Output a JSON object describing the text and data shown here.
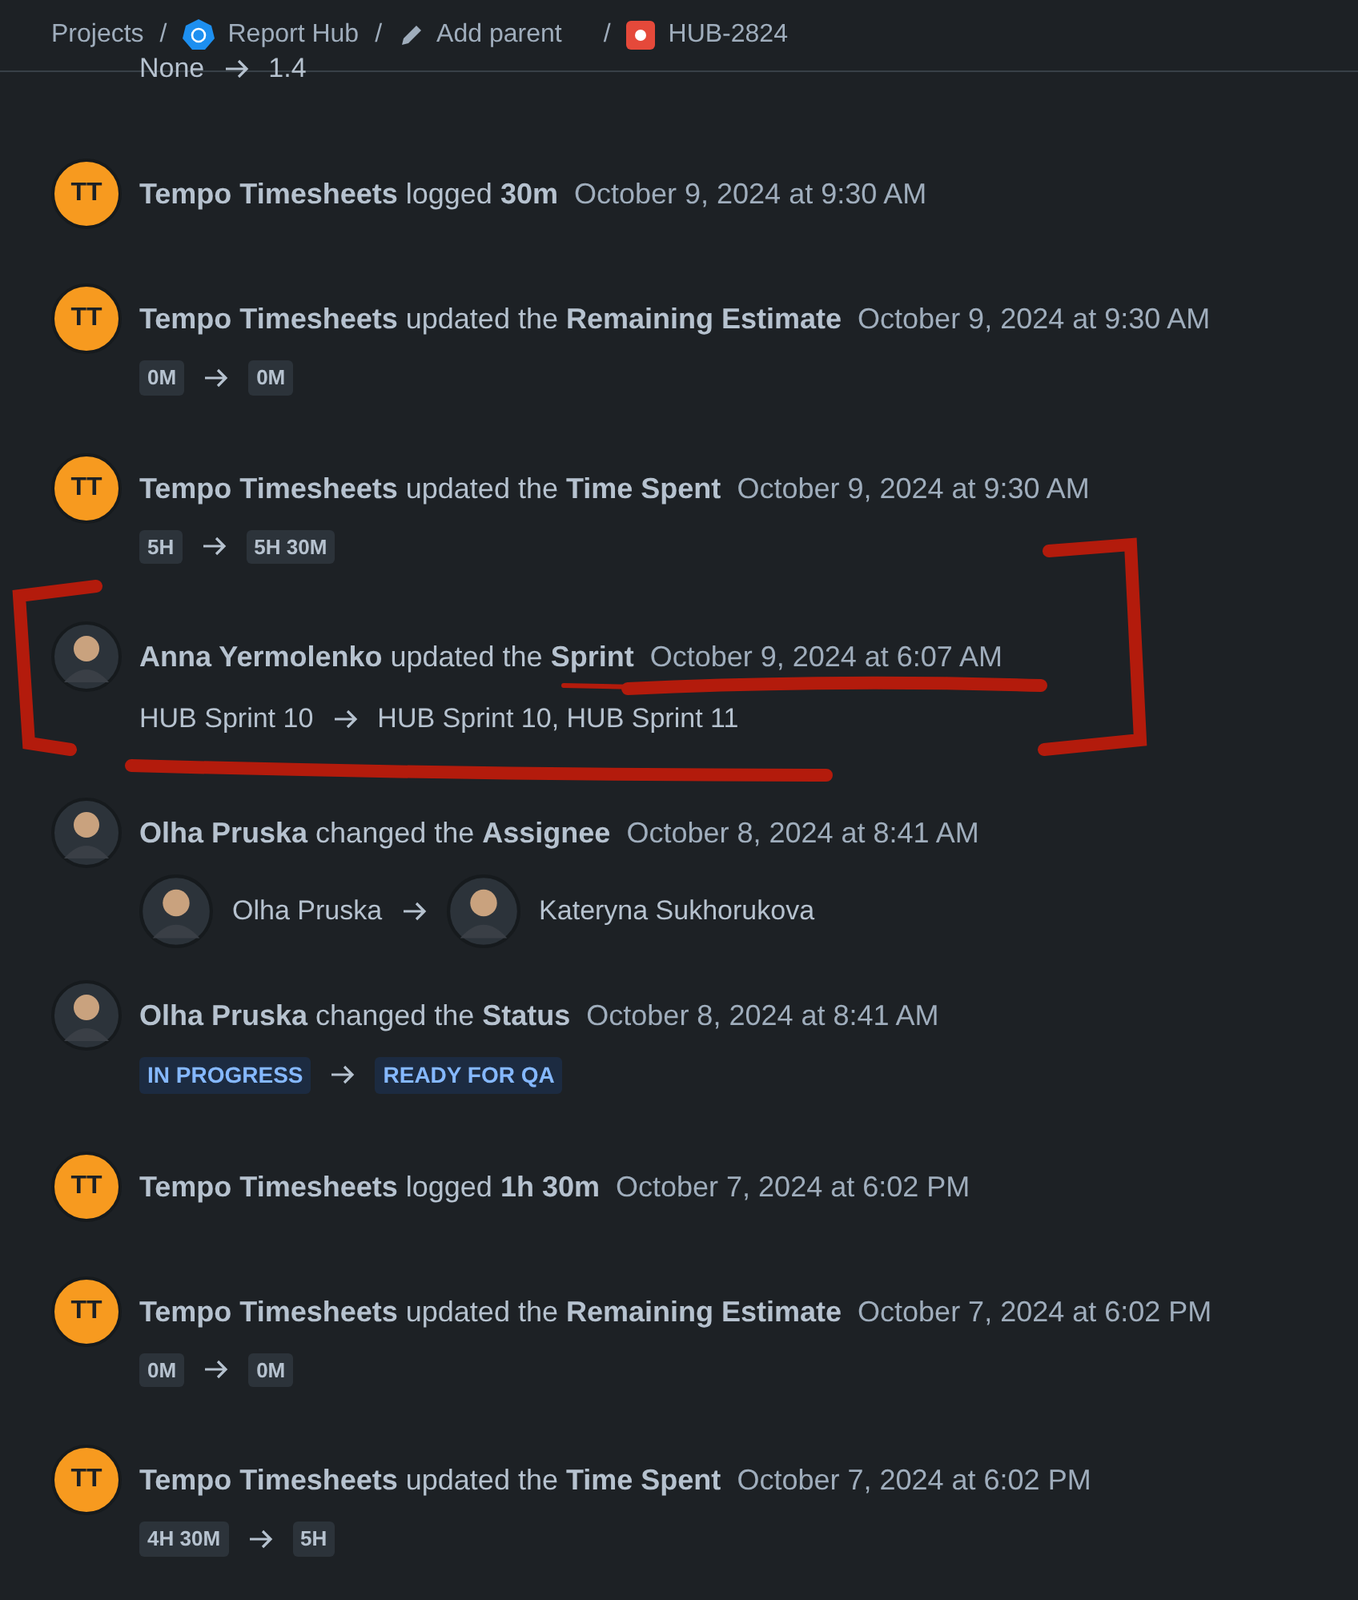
{
  "breadcrumbs": [
    {
      "label": "Projects",
      "kind": "plain",
      "separator": "/"
    },
    {
      "label": "Report Hub",
      "kind": "project",
      "separator": "/"
    },
    {
      "label": "Add parent",
      "kind": "action",
      "separator": "/"
    },
    {
      "label": "HUB-2824",
      "kind": "issue"
    }
  ],
  "partial_change": {
    "from": "None",
    "to": "1.4"
  },
  "entries": [
    {
      "avatar": {
        "kind": "initials",
        "text": "TT"
      },
      "headline": "**Tempo Timesheets** logged **30m**",
      "date": "October 9, 2024 at 9:30 AM"
    },
    {
      "avatar": {
        "kind": "initials",
        "text": "TT"
      },
      "headline": "**Tempo Timesheets** updated the **Remaining Estimate**",
      "date": "October 9, 2024 at 9:30 AM",
      "change": {
        "kind": "tag",
        "from": [
          "0M"
        ],
        "to": [
          "0M"
        ]
      }
    },
    {
      "avatar": {
        "kind": "initials",
        "text": "TT"
      },
      "headline": "**Tempo Timesheets** updated the **Time Spent**",
      "date": "October 9, 2024 at 9:30 AM",
      "change": {
        "kind": "tag",
        "from": [
          "5H"
        ],
        "to": [
          "5H 30M"
        ]
      }
    },
    {
      "avatar": {
        "kind": "photo"
      },
      "headline": "**Anna Yermolenko** updated the **Sprint**",
      "date": "October 9, 2024 at 6:07 AM",
      "change": {
        "kind": "text",
        "from": [
          "HUB Sprint 10"
        ],
        "to": [
          "HUB Sprint 10, HUB Sprint 11"
        ]
      }
    },
    {
      "avatar": {
        "kind": "photo"
      },
      "headline": "**Olha Pruska** changed the **Assignee**",
      "date": "October 8, 2024 at 8:41 AM",
      "change": {
        "kind": "user",
        "from": [
          "Olha Pruska"
        ],
        "to": [
          "Kateryna Sukhorukova"
        ]
      }
    },
    {
      "avatar": {
        "kind": "photo"
      },
      "headline": "**Olha Pruska** changed the **Status**",
      "date": "October 8, 2024 at 8:41 AM",
      "change": {
        "kind": "status",
        "from": [
          "IN PROGRESS"
        ],
        "to": [
          "READY FOR QA"
        ]
      }
    },
    {
      "avatar": {
        "kind": "initials",
        "text": "TT"
      },
      "headline": "**Tempo Timesheets** logged **1h 30m**",
      "date": "October 7, 2024 at 6:02 PM"
    },
    {
      "avatar": {
        "kind": "initials",
        "text": "TT"
      },
      "headline": "**Tempo Timesheets** updated the **Remaining Estimate**",
      "date": "October 7, 2024 at 6:02 PM",
      "change": {
        "kind": "tag",
        "from": [
          "0M"
        ],
        "to": [
          "0M"
        ]
      }
    },
    {
      "avatar": {
        "kind": "initials",
        "text": "TT"
      },
      "headline": "**Tempo Timesheets** updated the **Time Spent**",
      "date": "October 7, 2024 at 6:02 PM",
      "change": {
        "kind": "tag",
        "from": [
          "4H 30M"
        ],
        "to": [
          "5H"
        ]
      }
    }
  ]
}
